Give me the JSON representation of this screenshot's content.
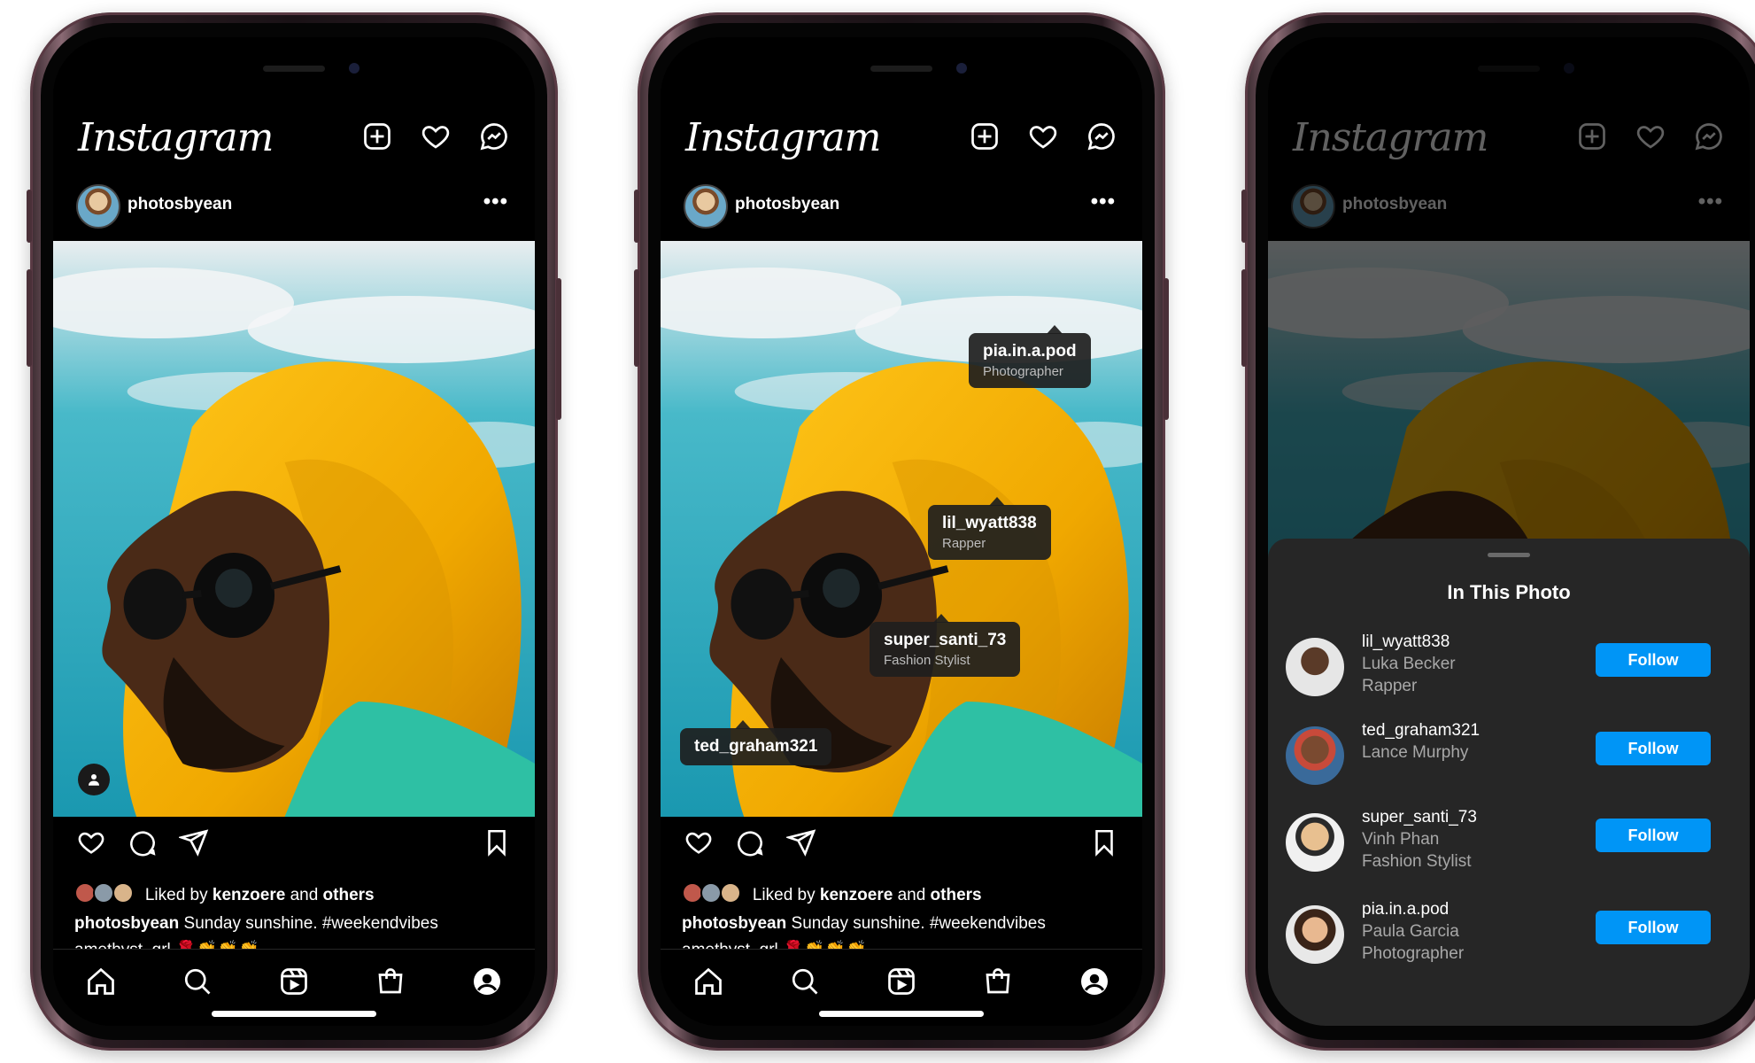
{
  "app": {
    "logo": "Instagram"
  },
  "post": {
    "username": "photosbyean",
    "more": "•••",
    "liked_prefix": "Liked by",
    "liked_user": "kenzoere",
    "liked_and": "and",
    "liked_others": "others",
    "caption_user": "photosbyean",
    "caption_text": "Sunday sunshine. #weekendvibes",
    "comment_preview": "amethyst_grl 🌹👏👏👏"
  },
  "tags": [
    {
      "username": "pia.in.a.pod",
      "role": "Photographer"
    },
    {
      "username": "lil_wyatt838",
      "role": "Rapper"
    },
    {
      "username": "super_santi_73",
      "role": "Fashion Stylist"
    },
    {
      "username": "ted_graham321",
      "role": ""
    }
  ],
  "sheet": {
    "title": "In This Photo",
    "follow_label": "Follow",
    "people": [
      {
        "username": "lil_wyatt838",
        "name": "Luka Becker",
        "role": "Rapper"
      },
      {
        "username": "ted_graham321",
        "name": "Lance Murphy",
        "role": ""
      },
      {
        "username": "super_santi_73",
        "name": "Vinh Phan",
        "role": "Fashion Stylist"
      },
      {
        "username": "pia.in.a.pod",
        "name": "Paula Garcia",
        "role": "Photographer"
      }
    ]
  },
  "icons": {
    "header": [
      "new-post-icon",
      "heart-icon",
      "messenger-icon"
    ],
    "actions": [
      "heart-icon",
      "comment-icon",
      "share-icon",
      "bookmark-icon"
    ],
    "nav": [
      "home-icon",
      "search-icon",
      "reels-icon",
      "shop-icon",
      "profile-icon"
    ]
  },
  "colors": {
    "follow": "#0095f6",
    "background": "#000000",
    "hood": "#f5b400",
    "sky": "#23a9b9"
  }
}
